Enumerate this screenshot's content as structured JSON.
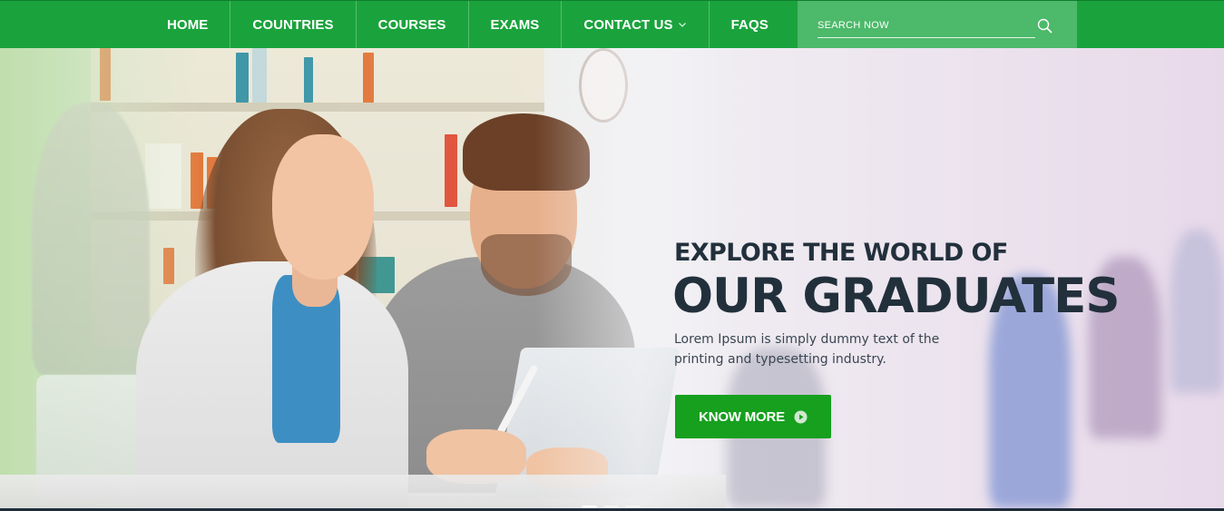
{
  "nav": {
    "items": [
      {
        "label": "HOME"
      },
      {
        "label": "COUNTRIES"
      },
      {
        "label": "COURSES"
      },
      {
        "label": "EXAMS"
      },
      {
        "label": "CONTACT US",
        "has_dropdown": true
      },
      {
        "label": "FAQS"
      }
    ],
    "search_placeholder": "SEARCH NOW",
    "search_icon": "search-icon"
  },
  "hero": {
    "kicker": "EXPLORE THE WORLD OF",
    "title": "OUR GRADUATES",
    "description": "Lorem Ipsum is simply dummy text of the printing and typesetting industry.",
    "button_label": "KNOW MORE",
    "button_icon": "play-circle-icon",
    "slider": {
      "count": 3,
      "active_index": 0
    }
  },
  "colors": {
    "nav_bg": "#1aa33c",
    "search_bg": "#4db96a",
    "button_bg": "#16a01e",
    "heading": "#22303c",
    "text": "#3a4653"
  }
}
